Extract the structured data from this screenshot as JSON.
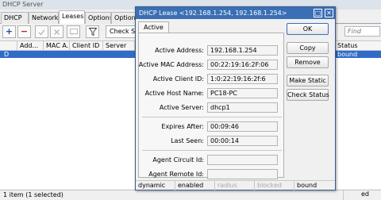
{
  "background": {
    "window_title": "DHCP Server",
    "tabs": [
      "DHCP",
      "Networks",
      "Leases",
      "Options",
      "Option S"
    ],
    "active_tab_index": 2,
    "toolbar": {
      "add_icon": "+",
      "remove_icon": "−",
      "check_label": "Check Sta",
      "find_placeholder": "Find"
    },
    "table": {
      "columns": [
        "",
        "Add...",
        "MAC A...",
        "Client ID",
        "Server",
        "Status"
      ],
      "row": {
        "flag": "D",
        "status": "bound"
      }
    },
    "status_left": "1 item (1 selected)",
    "status_right": "ed"
  },
  "dialog": {
    "title": "DHCP Lease <192.168.1.254, 192.168.1.254>",
    "maximize_icon": "□",
    "close_icon": "✕",
    "tab_label": "Active",
    "fields": {
      "active_address": {
        "label": "Active Address:",
        "value": "192.168.1.254"
      },
      "active_mac": {
        "label": "Active MAC Address:",
        "value": "00:22:19:16:2F:06"
      },
      "active_client_id": {
        "label": "Active Client ID:",
        "value": "1:0:22:19:16:2f:6"
      },
      "active_host_name": {
        "label": "Active Host Name:",
        "value": "PC18-PC"
      },
      "active_server": {
        "label": "Active Server:",
        "value": "dhcp1"
      },
      "expires_after": {
        "label": "Expires After:",
        "value": "00:09:46"
      },
      "last_seen": {
        "label": "Last Seen:",
        "value": "00:00:14"
      },
      "agent_circuit_id": {
        "label": "Agent Circuit Id:",
        "value": ""
      },
      "agent_remote_id": {
        "label": "Agent Remote Id:",
        "value": ""
      }
    },
    "buttons": {
      "ok": "OK",
      "copy": "Copy",
      "remove": "Remove",
      "make_static": "Make Static",
      "check_status": "Check Status"
    },
    "status_bar": [
      "dynamic",
      "enabled",
      "radius",
      "blocked",
      "bound"
    ]
  }
}
